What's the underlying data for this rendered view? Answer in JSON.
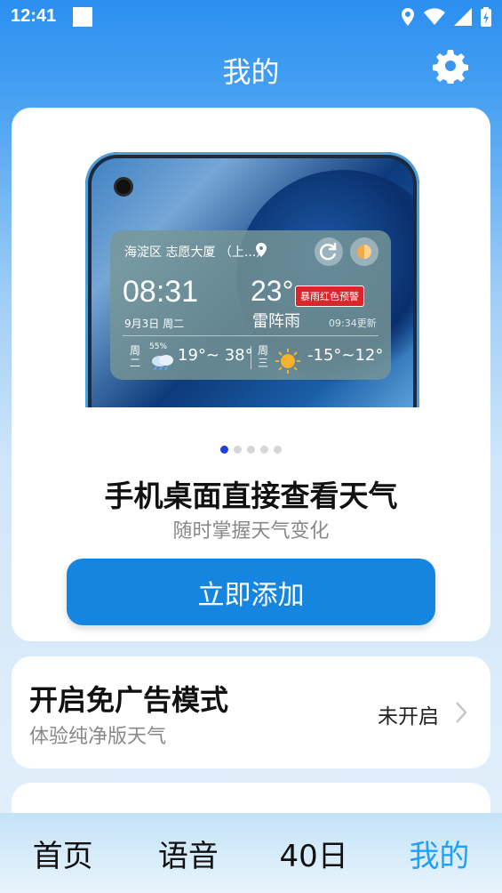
{
  "status_bar": {
    "time": "12:41",
    "icons": [
      "location-icon",
      "wifi-icon",
      "signal-icon",
      "battery-icon"
    ]
  },
  "header": {
    "title": "我的",
    "settings_icon": "gear-icon"
  },
  "promo": {
    "widget": {
      "location": "海淀区 志愿大厦 （上...）",
      "time": "08:31",
      "date": "9月3日  周二",
      "temperature": "23°",
      "condition": "雷阵雨",
      "alert": "暴雨红色预警",
      "updated": "09:34更新",
      "forecast": [
        {
          "day": "周二",
          "humidity": "55%",
          "icon": "rain-cloud-icon",
          "range": "19°~ 38°"
        },
        {
          "day": "周三",
          "icon": "sun-icon",
          "range": "-15°~12°"
        }
      ]
    },
    "carousel": {
      "count": 5,
      "active": 0
    },
    "title": "手机桌面直接查看天气",
    "subtitle": "随时掌握天气变化",
    "button_label": "立即添加"
  },
  "adfree": {
    "title": "开启免广告模式",
    "subtitle": "体验纯净版天气",
    "status": "未开启"
  },
  "bottom_nav": {
    "items": [
      {
        "label": "首页"
      },
      {
        "label": "语音"
      },
      {
        "label": "40日"
      },
      {
        "label": "我的"
      }
    ],
    "active_index": 3,
    "active_color": "#1ea0ff"
  },
  "colors": {
    "accent": "#1585e0",
    "alert_red": "#d8262a"
  }
}
